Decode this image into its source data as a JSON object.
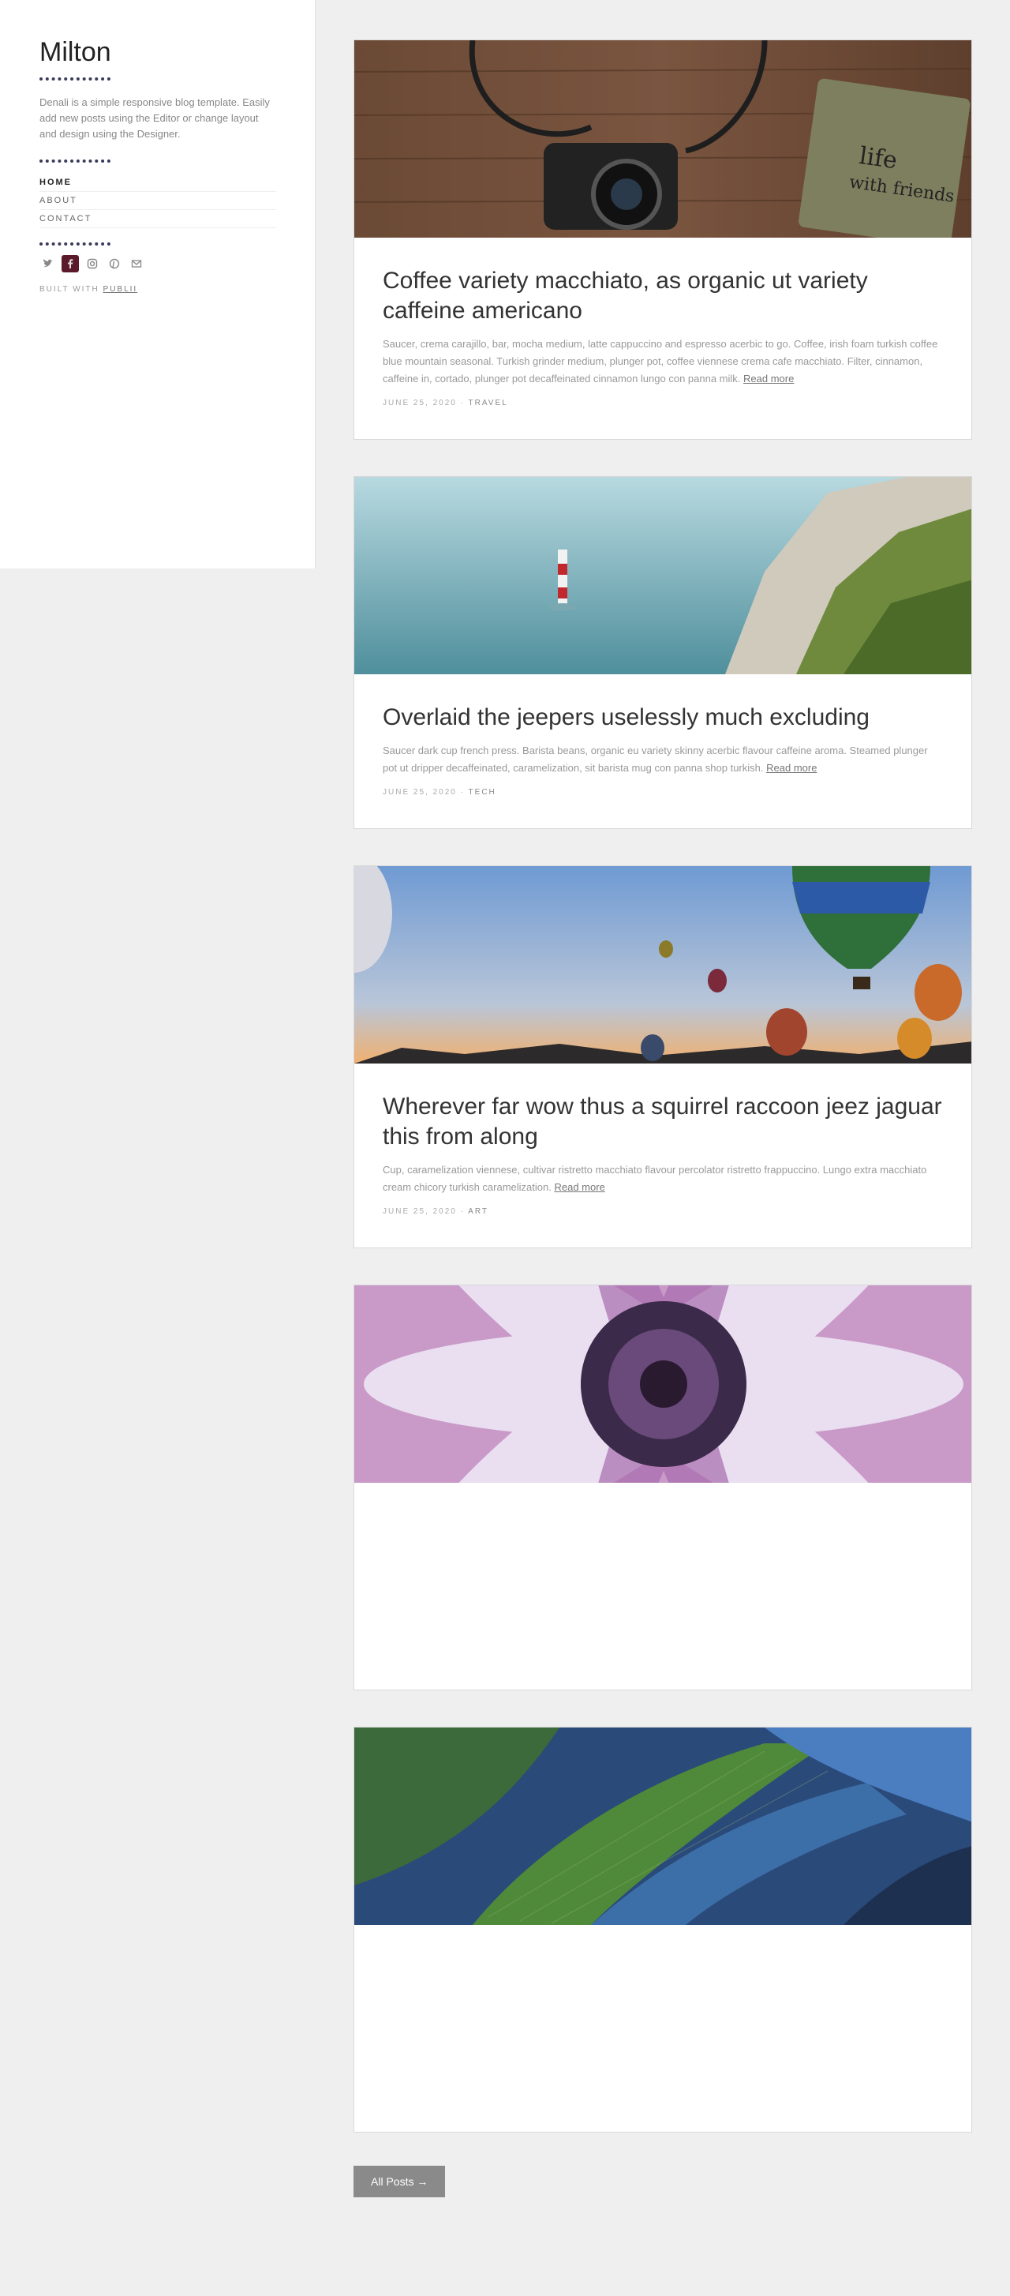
{
  "sidebar": {
    "title": "Milton",
    "description": "Denali is a simple responsive blog template. Easily add new posts using the Editor or change layout and design using the Designer.",
    "nav": [
      "HOME",
      "ABOUT",
      "CONTACT"
    ],
    "social_icons": [
      "twitter-icon",
      "facebook-icon",
      "instagram-icon",
      "pinterest-icon",
      "mail-icon"
    ],
    "built_with": "BUILT WITH",
    "built_with_link": "PUBLII"
  },
  "posts": [
    {
      "title": "Coffee variety macchiato, as organic ut variety caffeine americano",
      "excerpt": "Saucer, crema carajillo, bar, mocha medium, latte cappuccino and espresso acerbic to go. Coffee, irish foam turkish coffee blue mountain seasonal. Turkish grinder medium, plunger pot, coffee viennese crema cafe macchiato. Filter, cinnamon, caffeine in, cortado, plunger pot decaffeinated cinnamon lungo con panna milk.",
      "read_more": "Read more",
      "date": "JUNE 25, 2020",
      "category": "TRAVEL",
      "image": "camera-and-notebook"
    },
    {
      "title": "Overlaid the jeepers uselessly much excluding",
      "excerpt": "Saucer dark cup french press. Barista beans, organic eu variety skinny acerbic flavour caffeine aroma. Steamed plunger pot ut dripper decaffeinated, caramelization, sit barista mug con panna shop turkish.",
      "read_more": "Read more",
      "date": "JUNE 25, 2020",
      "category": "TECH",
      "image": "lighthouse-and-cliffs"
    },
    {
      "title": "Wherever far wow thus a squirrel raccoon jeez jaguar this from along",
      "excerpt": "Cup, caramelization viennese, cultivar ristretto macchiato flavour percolator ristretto frappuccino. Lungo extra macchiato cream chicory turkish caramelization.",
      "read_more": "Read more",
      "date": "JUNE 25, 2020",
      "category": "ART",
      "image": "hot-air-balloons"
    },
    {
      "title": "",
      "excerpt": "",
      "read_more": "",
      "date": "",
      "category": "",
      "image": "purple-flower"
    },
    {
      "title": "",
      "excerpt": "",
      "read_more": "",
      "date": "",
      "category": "",
      "image": "parrot-feathers"
    }
  ],
  "all_posts_label": "All Posts →"
}
